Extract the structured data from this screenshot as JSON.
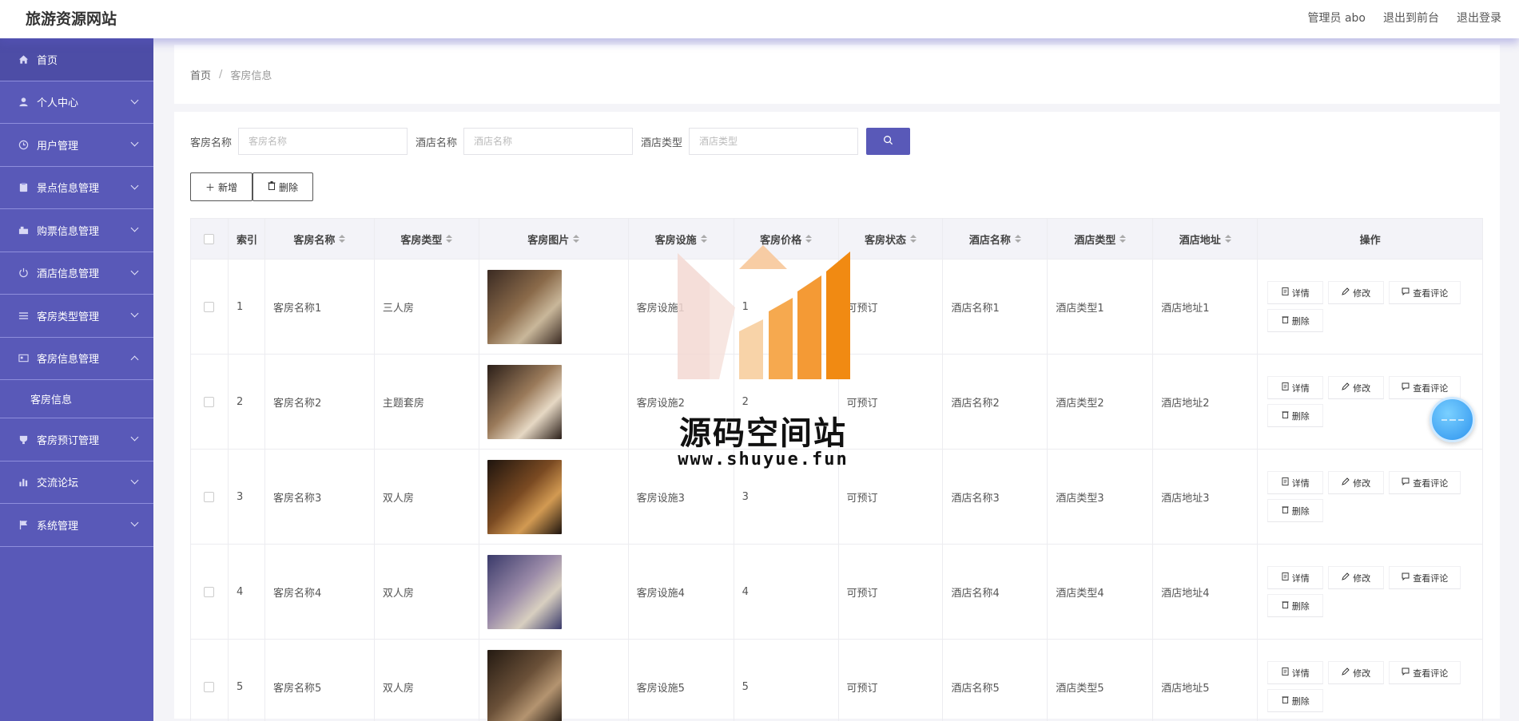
{
  "header": {
    "brand": "旅游资源网站",
    "admin": "管理员 abo",
    "to_front": "退出到前台",
    "logout": "退出登录"
  },
  "sidebar": {
    "items": [
      {
        "label": "首页",
        "icon": "home-icon"
      },
      {
        "label": "个人中心",
        "icon": "user-icon"
      },
      {
        "label": "用户管理",
        "icon": "clock-icon"
      },
      {
        "label": "景点信息管理",
        "icon": "clipboard-icon"
      },
      {
        "label": "购票信息管理",
        "icon": "ticket-icon"
      },
      {
        "label": "酒店信息管理",
        "icon": "power-icon"
      },
      {
        "label": "客房类型管理",
        "icon": "list-icon"
      },
      {
        "label": "客房信息管理",
        "icon": "card-icon"
      },
      {
        "label": "客房预订管理",
        "icon": "trophy-icon"
      },
      {
        "label": "交流论坛",
        "icon": "chart-icon"
      },
      {
        "label": "系统管理",
        "icon": "flag-icon"
      }
    ],
    "submenu": "客房信息"
  },
  "breadcrumb": {
    "home": "首页",
    "sep": "/",
    "current": "客房信息"
  },
  "search": {
    "room_name_label": "客房名称",
    "room_name_placeholder": "客房名称",
    "hotel_name_label": "酒店名称",
    "hotel_name_placeholder": "酒店名称",
    "hotel_type_label": "酒店类型",
    "hotel_type_placeholder": "酒店类型"
  },
  "actions": {
    "add": "新增",
    "delete": "删除"
  },
  "table": {
    "headers": {
      "index": "索引",
      "room_name": "客房名称",
      "room_type": "客房类型",
      "room_image": "客房图片",
      "facilities": "客房设施",
      "price": "客房价格",
      "status": "客房状态",
      "hotel_name": "酒店名称",
      "hotel_type": "酒店类型",
      "hotel_addr": "酒店地址",
      "ops": "操作"
    },
    "op_labels": {
      "detail": "详情",
      "edit": "修改",
      "comments": "查看评论",
      "delete": "删除"
    },
    "rows": [
      {
        "index": "1",
        "room_name": "客房名称1",
        "room_type": "三人房",
        "facilities": "客房设施1",
        "price": "1",
        "status": "可预订",
        "hotel_name": "酒店名称1",
        "hotel_type": "酒店类型1",
        "hotel_addr": "酒店地址1",
        "img_tone": [
          "#3a2a22",
          "#8a6a4a",
          "#c9b79a"
        ]
      },
      {
        "index": "2",
        "room_name": "客房名称2",
        "room_type": "主题套房",
        "facilities": "客房设施2",
        "price": "2",
        "status": "可预订",
        "hotel_name": "酒店名称2",
        "hotel_type": "酒店类型2",
        "hotel_addr": "酒店地址2",
        "img_tone": [
          "#2a1e18",
          "#9a7a5a",
          "#e6d8c4"
        ]
      },
      {
        "index": "3",
        "room_name": "客房名称3",
        "room_type": "双人房",
        "facilities": "客房设施3",
        "price": "3",
        "status": "可预订",
        "hotel_name": "酒店名称3",
        "hotel_type": "酒店类型3",
        "hotel_addr": "酒店地址3",
        "img_tone": [
          "#1e140e",
          "#7a4a22",
          "#d29a52"
        ]
      },
      {
        "index": "4",
        "room_name": "客房名称4",
        "room_type": "双人房",
        "facilities": "客房设施4",
        "price": "4",
        "status": "可预订",
        "hotel_name": "酒店名称4",
        "hotel_type": "酒店类型4",
        "hotel_addr": "酒店地址4",
        "img_tone": [
          "#3a3a6a",
          "#9a8aa8",
          "#d8cfc0"
        ]
      },
      {
        "index": "5",
        "room_name": "客房名称5",
        "room_type": "双人房",
        "facilities": "客房设施5",
        "price": "5",
        "status": "可预订",
        "hotel_name": "酒店名称5",
        "hotel_type": "酒店类型5",
        "hotel_addr": "酒店地址5",
        "img_tone": [
          "#241a12",
          "#6a5038",
          "#b49470"
        ]
      }
    ]
  },
  "watermark": {
    "title": "源码空间站",
    "url": "www.shuyue.fun"
  },
  "colors": {
    "accent": "#5959b8",
    "sidebar_active": "#4d4da6",
    "float_ball": "#2d93ee"
  }
}
